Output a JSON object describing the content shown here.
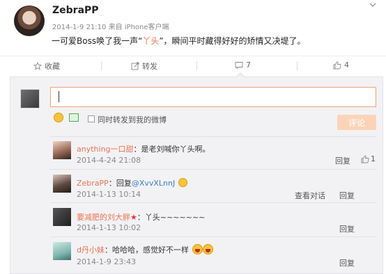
{
  "post": {
    "username": "ZebraPP",
    "timestamp": "2014-1-9 21:10",
    "source": "来自 iPhone客户端",
    "text_before": "一可爱Boss唤了我一声“",
    "text_highlight": "丫头",
    "text_after": "”，瞬间平时藏得好好的矫情又决堤了。"
  },
  "actions": {
    "favorite": "收藏",
    "forward": "转发",
    "comment_count": "7",
    "like_count": "4"
  },
  "reply_box": {
    "also_forward_label": "同时转发到我的微博",
    "submit_label": "评论"
  },
  "comments": [
    {
      "name": "anything一口甜",
      "text": "：是老刘喊你丫头啊。",
      "time": "2014-4-24 21:08",
      "reply_label": "回复",
      "like_count": "1"
    },
    {
      "name": "ZebraPP",
      "text": "：回复",
      "mention": "@XvvXLnnJ",
      "time": "2014-1-13 10:14",
      "view_dialog_label": "查看对话",
      "reply_label": "回复"
    },
    {
      "name": "要减肥的刘大胖",
      "text": "：丫头~~~~~~~",
      "time": "2014-1-13 10:02",
      "reply_label": "回复"
    },
    {
      "name": "d丹小妹",
      "text": "：哈哈哈，感觉好不一样",
      "time": "2014-1-9 23:43",
      "reply_label": "回复"
    }
  ],
  "colors": {
    "accent": "#eb7350",
    "link_blue": "#3f7fc6",
    "panel_bg": "#f2f2f5"
  }
}
